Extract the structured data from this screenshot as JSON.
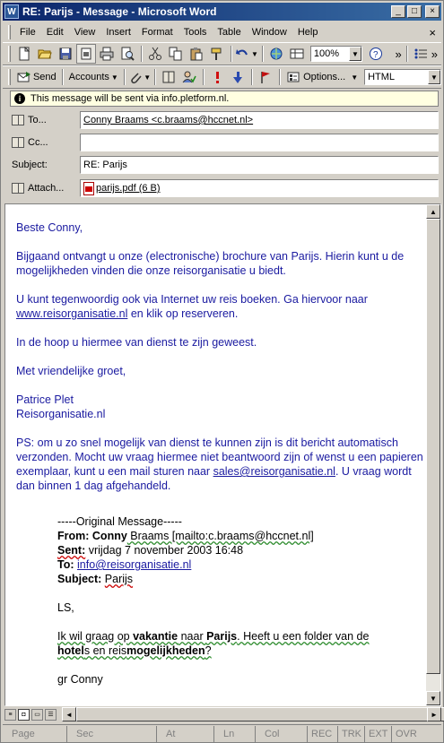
{
  "window": {
    "title": "RE: Parijs - Message - Microsoft Word",
    "app_icon": "W",
    "buttons": {
      "minimize": "_",
      "maximize": "□",
      "close": "×"
    }
  },
  "menu": {
    "items": [
      "File",
      "Edit",
      "View",
      "Insert",
      "Format",
      "Tools",
      "Table",
      "Window",
      "Help"
    ],
    "more": "»"
  },
  "toolbar1": {
    "zoom": "100%",
    "more": "»"
  },
  "toolbar2": {
    "send_label": "Send",
    "accounts_label": "Accounts",
    "options_label": "Options...",
    "format_value": "HTML"
  },
  "infobar": {
    "text": "This message will be sent via info.pletform.nl."
  },
  "fields": {
    "to_label": "To...",
    "to_value": "Conny Braams <c.braams@hccnet.nl>",
    "cc_label": "Cc...",
    "cc_value": "",
    "subject_label": "Subject:",
    "subject_value": "RE: Parijs",
    "attach_label": "Attach...",
    "attach_value": "parijs.pdf (6 B)"
  },
  "message": {
    "greeting": "Beste Conny,",
    "p1": "Bijgaand ontvangt u onze (electronische) brochure van Parijs. Hierin kunt u de mogelijkheden vinden die onze reisorganisatie u biedt.",
    "p2_before": "U kunt tegenwoordig ook via Internet uw reis boeken. Ga hiervoor naar ",
    "p2_link": "www.reisorganisatie.nl",
    "p2_after": " en klik op reserveren.",
    "p3": "In de hoop u hiermee van dienst te zijn geweest.",
    "p4": "Met vriendelijke groet,",
    "sig_name": "Patrice Plet",
    "sig_company": "Reisorganisatie.nl",
    "ps_before": "PS: om u zo snel mogelijk van dienst te kunnen zijn is dit bericht automatisch verzonden. Mocht uw vraag hiermee niet beantwoord zijn of wenst u een papieren exemplaar, kunt u een mail sturen naar ",
    "ps_link": "sales@reisorganisatie.nl",
    "ps_after": ". U vraag wordt dan binnen 1 dag afgehandeld."
  },
  "original": {
    "header": "-----Original Message-----",
    "from_label": "From:",
    "from_name": "Conny",
    "from_rest": " Braams [mailto:c.braams@hccnet.nl]",
    "sent_label": "Sent:",
    "sent_value": " vrijdag 7 november 2003 16:48",
    "to_label": "To:",
    "to_value": "info@reisorganisatie.nl",
    "subject_label": "Subject:",
    "subject_value": "Parijs",
    "salutation": "LS,",
    "q_1": "Ik wil graag op ",
    "q_2": "vakantie",
    "q_3": " naar ",
    "q_4": "Parijs",
    "q_5": ". Heeft u een folder van de ",
    "q_6": "hotel",
    "q_7": "s en reis",
    "q_8": "mogelijkheden",
    "q_9": "?",
    "closing": "gr Conny"
  },
  "status": {
    "page": "Page",
    "sec": "Sec",
    "at": "At",
    "ln": "Ln",
    "col": "Col",
    "rec": "REC",
    "trk": "TRK",
    "ext": "EXT",
    "ovr": "OVR"
  }
}
